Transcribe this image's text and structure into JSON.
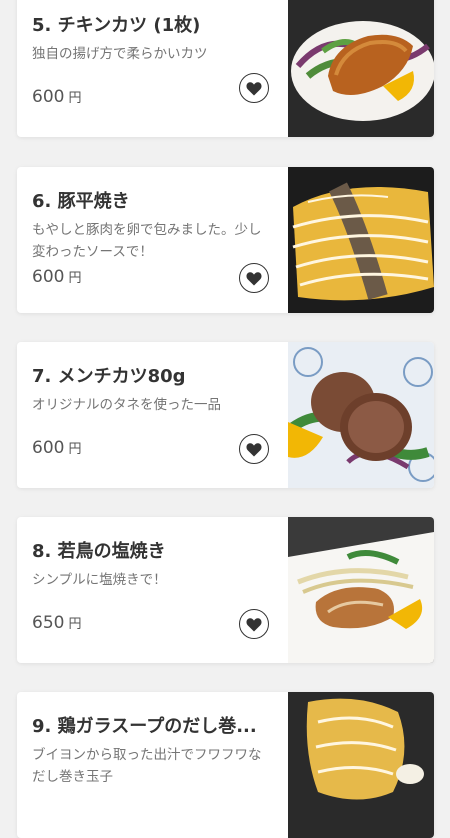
{
  "menu_items": [
    {
      "title": "5. チキンカツ (1枚)",
      "description": "独自の揚げ方で柔らかいカツ",
      "price": "600",
      "currency": "円",
      "favorite_icon": "heart-icon"
    },
    {
      "title": "6. 豚平焼き",
      "description": "もやしと豚肉を卵で包みました。少し変わったソースで！",
      "price": "600",
      "currency": "円",
      "favorite_icon": "heart-icon"
    },
    {
      "title": "7. メンチカツ80g",
      "description": "オリジナルのタネを使った一品",
      "price": "600",
      "currency": "円",
      "favorite_icon": "heart-icon"
    },
    {
      "title": "8. 若鳥の塩焼き",
      "description": "シンプルに塩焼きで！",
      "price": "650",
      "currency": "円",
      "favorite_icon": "heart-icon"
    },
    {
      "title": "9. 鶏ガラスープのだし巻...",
      "description": "ブイヨンから取った出汁でフワフワなだし巻き玉子",
      "price": "",
      "currency": "",
      "favorite_icon": "heart-icon"
    }
  ],
  "colors": {
    "background": "#f1f1f1",
    "card": "#ffffff",
    "title": "#333333",
    "description": "#757575",
    "price": "#555555"
  }
}
